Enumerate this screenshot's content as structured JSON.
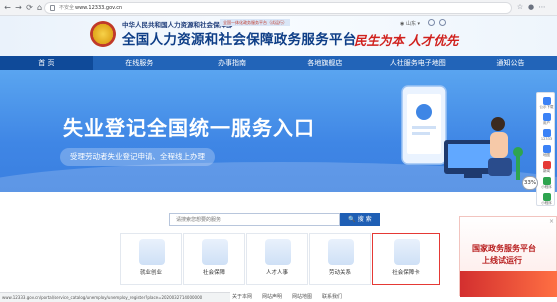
{
  "browser": {
    "security_label": "不安全",
    "url": "www.12333.gov.cn"
  },
  "header": {
    "org_small": "中华人民共和国人力资源和社会保障部",
    "slogan_chip": "全国一体化政务服务平台（试运行）",
    "title": "全国人力资源和社会保障政务服务平台",
    "calligraphy": "民生为本 人才优先",
    "location": "山东"
  },
  "nav": {
    "items": [
      "首 页",
      "在线服务",
      "办事指南",
      "各地旗舰店",
      "人社服务电子地图",
      "通知公告"
    ]
  },
  "banner": {
    "title": "失业登记全国统一服务入口",
    "subtitle": "受理劳动者失业登记申请、全程线上办理"
  },
  "sidebar": {
    "items": [
      "公示下载",
      "用户",
      "12333",
      "地图",
      "新闻",
      "小程序",
      "小程序"
    ]
  },
  "badge": "33%",
  "search": {
    "placeholder": "请搜索您想要的服务",
    "button": "搜 索"
  },
  "services": [
    {
      "label": "就业创业"
    },
    {
      "label": "社会保障"
    },
    {
      "label": "人才人事"
    },
    {
      "label": "劳动关系"
    },
    {
      "label": "社会保障卡"
    }
  ],
  "promo": {
    "line1": "国家政务服务平台",
    "line2": "上线试运行",
    "close": "×"
  },
  "status_bar": {
    "text": "www.12333.gov.cn/portal/service_catalog/unemploy/unemploy_register?place=2020032714000000"
  },
  "footer": {
    "links": [
      "关于本网",
      "网站声明",
      "网站地图",
      "联系我们"
    ]
  },
  "colors": {
    "nav_bg": "#2264b8",
    "nav_active": "#0f4a99",
    "title_blue": "#0e3e87",
    "accent_red": "#d0211d",
    "search_button": "#1f5fb5",
    "highlight_border": "#e53935"
  }
}
